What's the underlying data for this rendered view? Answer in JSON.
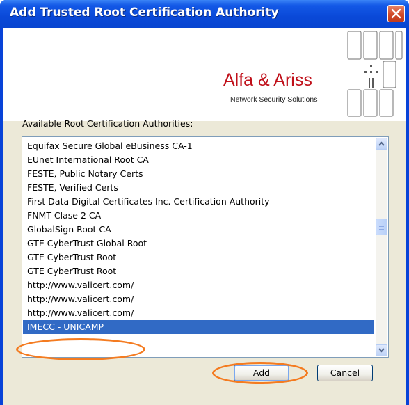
{
  "window": {
    "title": "Add Trusted Root Certification Authority"
  },
  "banner": {
    "logo_name": "Alfa & Ariss",
    "logo_tagline": "Network Security Solutions"
  },
  "list": {
    "label": "Available Root Certification Authorities:",
    "items": [
      "Equifax Secure Global eBusiness CA-1",
      "EUnet International Root CA",
      "FESTE, Public Notary Certs",
      "FESTE, Verified Certs",
      "First Data Digital Certificates Inc. Certification Authority",
      "FNMT Clase 2 CA",
      "GlobalSign Root CA",
      "GTE CyberTrust Global Root",
      "GTE CyberTrust Root",
      "GTE CyberTrust Root",
      "http://www.valicert.com/",
      "http://www.valicert.com/",
      "http://www.valicert.com/",
      "IMECC - UNICAMP"
    ],
    "selected_index": 13
  },
  "buttons": {
    "add_label": "Add",
    "cancel_label": "Cancel"
  },
  "colors": {
    "titlebar": "#0a49d8",
    "selection": "#316ac5",
    "annotation": "#f47b20",
    "logo_red": "#c0101a"
  },
  "icons": {
    "close": "close-icon",
    "scroll_up": "chevron-up-icon",
    "scroll_down": "chevron-down-icon"
  }
}
